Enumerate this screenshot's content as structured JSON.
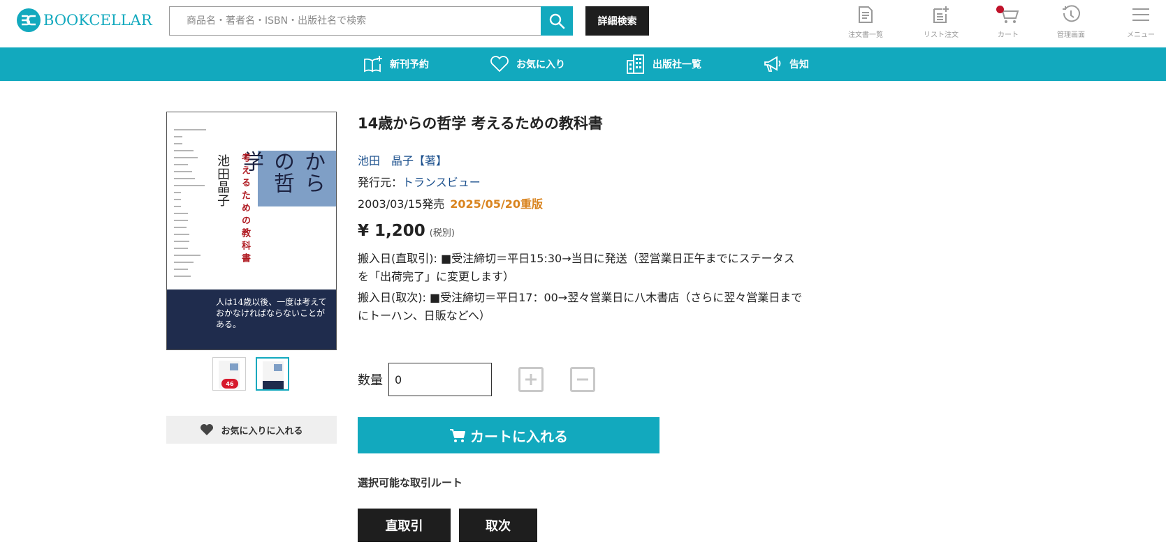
{
  "header": {
    "logo_text": "BOOKCELLAR",
    "search_placeholder": "商品名・著者名・ISBN・出版社名で検索",
    "advanced_search_label": "詳細検索",
    "icons": [
      {
        "name": "order-history-icon",
        "label": "注文書一覧"
      },
      {
        "name": "list-order-icon",
        "label": "リスト注文"
      },
      {
        "name": "cart-icon",
        "label": "カート"
      },
      {
        "name": "admin-icon",
        "label": "管理画面"
      },
      {
        "name": "menu-icon",
        "label": "メニュー"
      }
    ]
  },
  "nav": {
    "items": [
      {
        "label": "新刊予約",
        "icon": "new-book-icon"
      },
      {
        "label": "お気に入り",
        "icon": "heart-icon"
      },
      {
        "label": "出版社一覧",
        "icon": "building-icon"
      },
      {
        "label": "告知",
        "icon": "megaphone-icon"
      }
    ]
  },
  "product": {
    "title": "14歳からの哲学 考えるための教科書",
    "author": "池田　晶子【著】",
    "publisher_label": "発行元：",
    "publisher": "トランスビュー",
    "release_date": "2003/03/15発売",
    "reprint": "2025/05/20重版",
    "price": "¥ 1,200",
    "tax_note": "(税別)",
    "shipping_direct": "搬入日(直取引):  ■受注締切＝平日15:30→当日に発送（翌営業日正午までにステータスを「出荷完了」に変更します）",
    "shipping_agency": "搬入日(取次):  ■受注締切＝平日17：00→翌々営業日に八木書店（さらに翌々営業日までにトーハン、日販などへ）",
    "quantity_label": "数量",
    "quantity_value": "0",
    "add_to_cart_label": "カートに入れる",
    "add_to_favorites_label": "お気に入りに入れる",
    "route_label": "選択可能な取引ルート",
    "routes": [
      "直取引",
      "取次"
    ],
    "thumb_badge": "46"
  },
  "cover": {
    "title": "14歳からの哲学",
    "subtitle": "考えるための教科書",
    "author": "池田晶子",
    "tagline": "人は14歳以後、一度は考えておかなければならないことがある。"
  },
  "colors": {
    "brand": "#12a9be",
    "dark_button": "#1e1e1e",
    "reprint": "#d9841f",
    "link": "#1a4f8c",
    "cart_dot": "#c0122a"
  }
}
